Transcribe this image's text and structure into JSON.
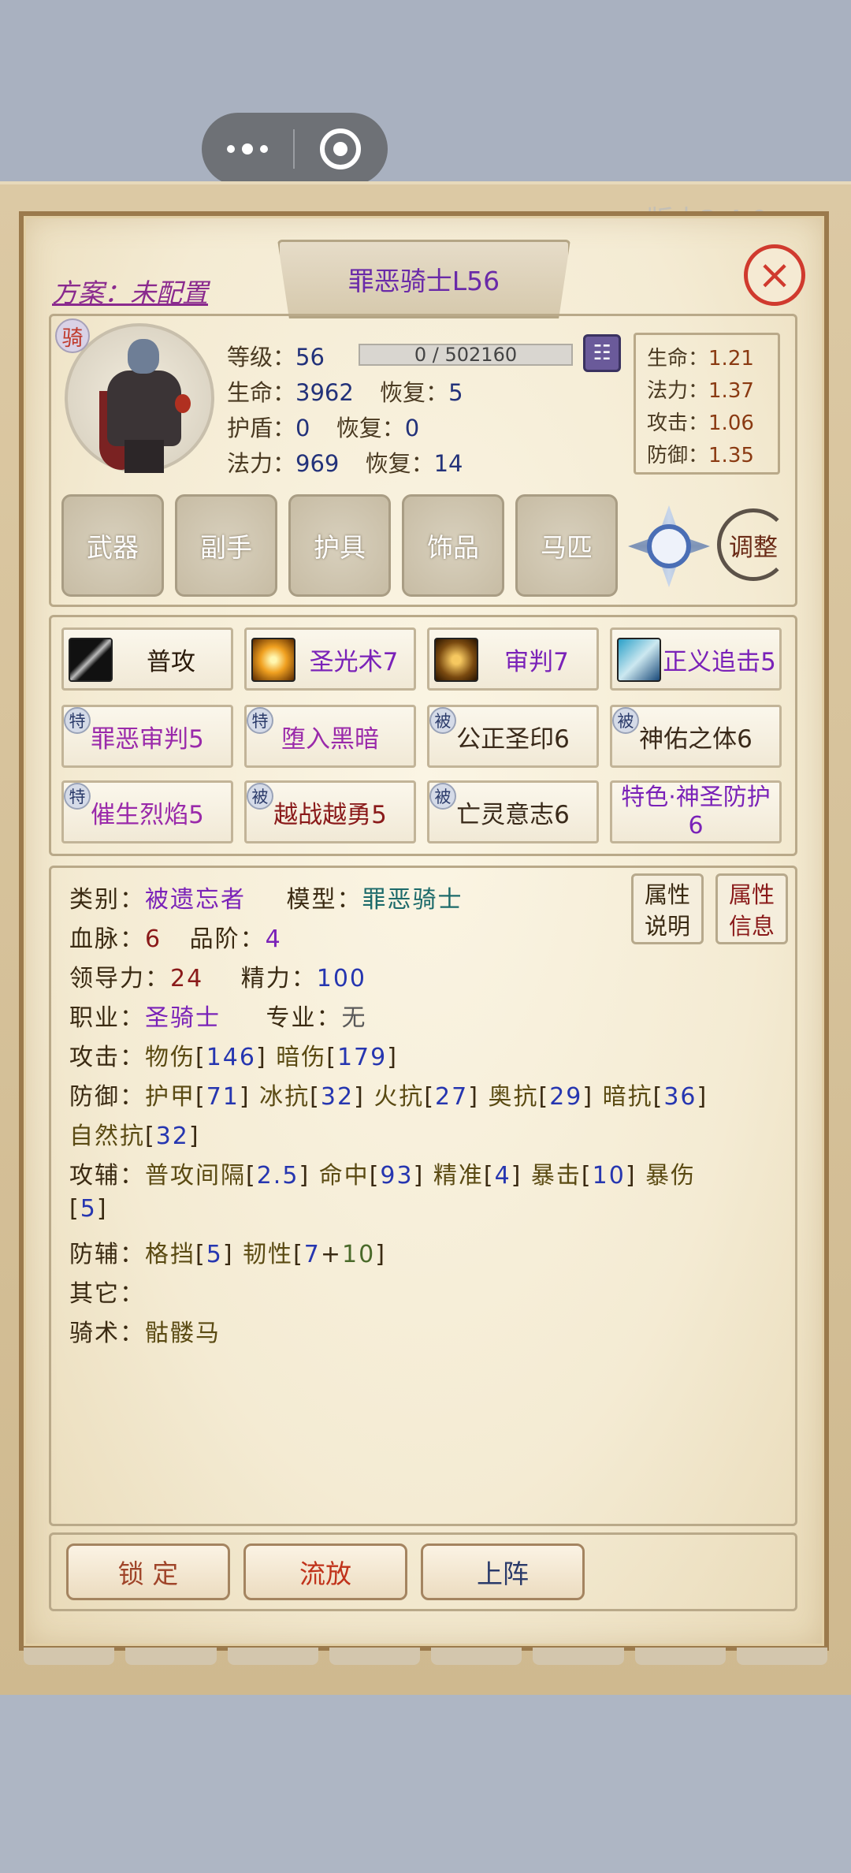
{
  "header": {
    "scheme": "方案：未配置",
    "title": "罪恶骑士L56",
    "version_ghost": "版本3.4.0"
  },
  "hero": {
    "class_badge": "骑",
    "level_label": "等级：",
    "level": "56",
    "xp": "0 / 502160",
    "hp_label": "生命：",
    "hp": "3962",
    "hp_regen_label": "恢复：",
    "hp_regen": "5",
    "shield_label": "护盾：",
    "shield": "0",
    "shield_regen_label": "恢复：",
    "shield_regen": "0",
    "mana_label": "法力：",
    "mana": "969",
    "mana_regen_label": "恢复：",
    "mana_regen": "14"
  },
  "growth": [
    {
      "label": "生命：",
      "value": "1.21"
    },
    {
      "label": "法力：",
      "value": "1.37"
    },
    {
      "label": "攻击：",
      "value": "1.06"
    },
    {
      "label": "防御：",
      "value": "1.35"
    }
  ],
  "equipment": [
    "武器",
    "副手",
    "护具",
    "饰品",
    "马匹"
  ],
  "adjust_label": "调整",
  "skills": [
    {
      "name": "普攻",
      "icon": "sword-icon",
      "tag": "",
      "color": "#2a1a0a"
    },
    {
      "name": "圣光术7",
      "icon": "holy-light-icon",
      "tag": "",
      "color": "#7a22b8"
    },
    {
      "name": "审判7",
      "icon": "judgment-icon",
      "tag": "",
      "color": "#7a22b8"
    },
    {
      "name": "正义追击5",
      "icon": "justice-chase-icon",
      "tag": "",
      "color": "#7a22b8"
    },
    {
      "name": "罪恶审判5",
      "tag": "特",
      "color": "#9a2aaa"
    },
    {
      "name": "堕入黑暗",
      "tag": "特",
      "color": "#9a2aaa"
    },
    {
      "name": "公正圣印6",
      "tag": "被",
      "color": "#3a2a1a"
    },
    {
      "name": "神佑之体6",
      "tag": "被",
      "color": "#3a2a1a"
    },
    {
      "name": "催生烈焰5",
      "tag": "特",
      "color": "#9a2aaa"
    },
    {
      "name": "越战越勇5",
      "tag": "被",
      "color": "#8a1a1a"
    },
    {
      "name": "亡灵意志6",
      "tag": "被",
      "color": "#3a2a1a"
    },
    {
      "name": "特色·神圣防护",
      "name2": "6",
      "tag": "",
      "color": "#7a22b8"
    }
  ],
  "info": {
    "category_label": "类别：",
    "category": "被遗忘者",
    "model_label": "模型：",
    "model": "罪恶骑士",
    "blood_label": "血脉：",
    "blood": "6",
    "grade_label": "品阶：",
    "grade": "4",
    "leadership_label": "领导力：",
    "leadership": "24",
    "energy_label": "精力：",
    "energy": "100",
    "job_label": "职业：",
    "job": "圣骑士",
    "specialty_label": "专业：",
    "specialty": "无",
    "attack_label": "攻击：",
    "phys_label": "物伤",
    "phys": "146",
    "dark_label": "暗伤",
    "dark": "179",
    "defense_label": "防御：",
    "armor_label": "护甲",
    "armor": "71",
    "ice_label": "冰抗",
    "ice": "32",
    "fire_label": "火抗",
    "fire": "27",
    "arcane_label": "奥抗",
    "arcane": "29",
    "shadow_label": "暗抗",
    "shadow": "36",
    "nature_label": "自然抗",
    "nature": "32",
    "atk_aux_label": "攻辅：",
    "interval_label": "普攻间隔",
    "interval": "2.5",
    "hit_label": "命中",
    "hit": "93",
    "precision_label": "精准",
    "precision": "4",
    "crit_label": "暴击",
    "crit": "10",
    "critdmg_label": "暴伤",
    "critdmg": "5",
    "def_aux_label": "防辅：",
    "block_label": "格挡",
    "block": "5",
    "tough_label": "韧性",
    "tough_a": "7",
    "tough_plus": "+",
    "tough_b": "10",
    "other_label": "其它：",
    "riding_label": "骑术：",
    "riding": "骷髅马"
  },
  "attr_buttons": {
    "explain_1": "属性",
    "explain_2": "说明",
    "info_1": "属性",
    "info_2": "信息"
  },
  "actions": {
    "lock": "锁 定",
    "exile": "流放",
    "deploy": "上阵"
  },
  "colors": {
    "lock": "#a0452a",
    "exile": "#c0321a",
    "deploy": "#2a3a6a"
  }
}
